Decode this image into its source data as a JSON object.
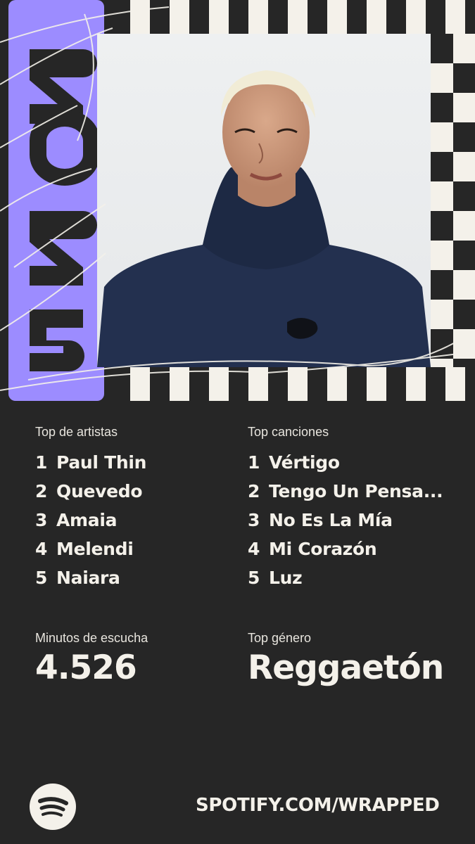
{
  "hero": {
    "year_badge": "2025",
    "accent_color": "#9c8cff",
    "photo_subject_icon": "artist-portrait"
  },
  "top_artists": {
    "label": "Top de artistas",
    "items": [
      {
        "rank": "1",
        "name": "Paul Thin"
      },
      {
        "rank": "2",
        "name": "Quevedo"
      },
      {
        "rank": "3",
        "name": "Amaia"
      },
      {
        "rank": "4",
        "name": "Melendi"
      },
      {
        "rank": "5",
        "name": "Naiara"
      }
    ]
  },
  "top_songs": {
    "label": "Top canciones",
    "items": [
      {
        "rank": "1",
        "name": "Vértigo"
      },
      {
        "rank": "2",
        "name": "Tengo Un Pensa..."
      },
      {
        "rank": "3",
        "name": "No Es La Mía"
      },
      {
        "rank": "4",
        "name": "Mi Corazón"
      },
      {
        "rank": "5",
        "name": "Luz"
      }
    ]
  },
  "minutes": {
    "label": "Minutos de escucha",
    "value": "4.526"
  },
  "genre": {
    "label": "Top género",
    "value": "Reggaetón"
  },
  "footer": {
    "logo_icon": "spotify-logo-icon",
    "url": "SPOTIFY.COM/WRAPPED"
  }
}
